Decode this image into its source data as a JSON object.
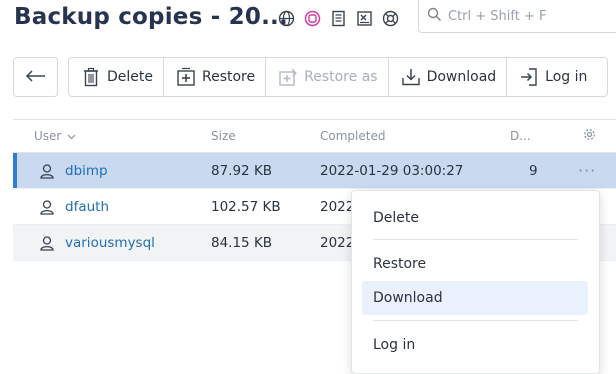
{
  "header": {
    "title": "Backup copies - 20...",
    "icons": [
      "globe-icon",
      "lifebuoy-pink-icon",
      "notes-icon",
      "spreadsheet-icon",
      "support-ring-icon"
    ]
  },
  "search": {
    "placeholder": "Ctrl + Shift + F",
    "value": ""
  },
  "toolbar": {
    "back_icon": "arrow-left-icon",
    "buttons": [
      {
        "label": "Delete",
        "icon": "trash-icon",
        "disabled": false
      },
      {
        "label": "Restore",
        "icon": "plus-square-icon",
        "disabled": false
      },
      {
        "label": "Restore as",
        "icon": "restore-as-icon",
        "disabled": true
      },
      {
        "label": "Download",
        "icon": "download-icon",
        "disabled": false
      },
      {
        "label": "Log in",
        "icon": "login-icon",
        "disabled": false
      }
    ]
  },
  "table": {
    "columns": [
      "User",
      "Size",
      "Completed",
      "D...",
      ""
    ],
    "rows": [
      {
        "user": "dbimp",
        "size": "87.92 KB",
        "completed": "2022-01-29 03:00:27",
        "d": "9",
        "selected": true
      },
      {
        "user": "dfauth",
        "size": "102.57 KB",
        "completed": "2022",
        "d": "",
        "selected": false
      },
      {
        "user": "variousmysql",
        "size": "84.15 KB",
        "completed": "2022",
        "d": "",
        "selected": false
      }
    ],
    "more_label": "···"
  },
  "context_menu": {
    "items": [
      "Delete",
      "Restore",
      "Download",
      "Log in"
    ],
    "hovered": "Download"
  },
  "colors": {
    "accent": "#2f7fd0",
    "selected_row": "#c9d9ef",
    "title": "#26344f",
    "link": "#1f6fb5"
  }
}
